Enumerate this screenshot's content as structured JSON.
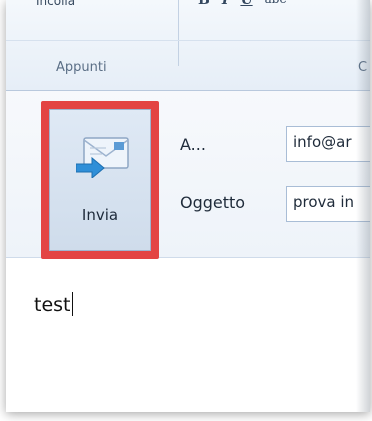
{
  "ribbon": {
    "clipboard_top_text": "Incolla",
    "format_buttons": [
      "B",
      "I",
      "U",
      "abe"
    ],
    "group_label": "Appunti",
    "next_group_label": "C"
  },
  "send_button": {
    "label": "Invia",
    "icon": "send-envelope-icon",
    "highlight_color": "#e34444"
  },
  "fields": {
    "to_label": "A...",
    "to_value": "info@ar",
    "subject_label": "Oggetto",
    "subject_value": "prova in"
  },
  "message": {
    "body": "test"
  }
}
